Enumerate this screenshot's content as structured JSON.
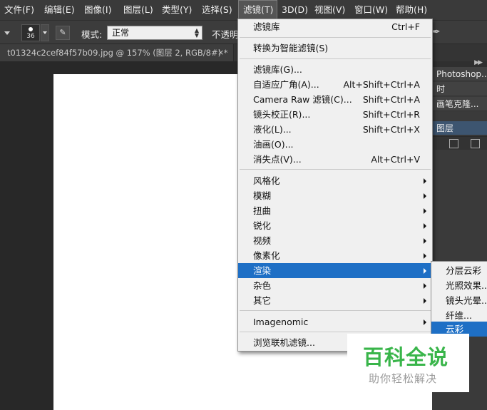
{
  "menubar": {
    "items": [
      "文件(F)",
      "编辑(E)",
      "图像(I)",
      "图层(L)",
      "类型(Y)",
      "选择(S)",
      "滤镜(T)",
      "3D(D)",
      "视图(V)",
      "窗口(W)",
      "帮助(H)"
    ]
  },
  "options": {
    "brush_size": "36",
    "mode_label": "模式:",
    "mode_value": "正常",
    "opacity_label": "不透明"
  },
  "document": {
    "tab_title": "t01324c2cef84f57b09.jpg @ 157% (图层 2, RGB/8#) *",
    "close": "×"
  },
  "right_panel": {
    "rows": [
      "Photoshop...",
      "时",
      "画笔克隆...",
      "图层"
    ]
  },
  "filter_menu": {
    "items": [
      {
        "label": "滤镜库",
        "shortcut": "Ctrl+F"
      },
      {
        "label": "转换为智能滤镜(S)",
        "shortcut": ""
      },
      {
        "label": "滤镜库(G)...",
        "shortcut": ""
      },
      {
        "label": "自适应广角(A)...",
        "shortcut": "Alt+Shift+Ctrl+A"
      },
      {
        "label": "Camera Raw 滤镜(C)...",
        "shortcut": "Shift+Ctrl+A"
      },
      {
        "label": "镜头校正(R)...",
        "shortcut": "Shift+Ctrl+R"
      },
      {
        "label": "液化(L)...",
        "shortcut": "Shift+Ctrl+X"
      },
      {
        "label": "油画(O)...",
        "shortcut": ""
      },
      {
        "label": "消失点(V)...",
        "shortcut": "Alt+Ctrl+V"
      },
      {
        "label": "风格化",
        "shortcut": ""
      },
      {
        "label": "模糊",
        "shortcut": ""
      },
      {
        "label": "扭曲",
        "shortcut": ""
      },
      {
        "label": "锐化",
        "shortcut": ""
      },
      {
        "label": "视频",
        "shortcut": ""
      },
      {
        "label": "像素化",
        "shortcut": ""
      },
      {
        "label": "渲染",
        "shortcut": ""
      },
      {
        "label": "杂色",
        "shortcut": ""
      },
      {
        "label": "其它",
        "shortcut": ""
      },
      {
        "label": "Imagenomic",
        "shortcut": ""
      },
      {
        "label": "浏览联机滤镜...",
        "shortcut": ""
      }
    ]
  },
  "render_submenu": {
    "items": [
      "分层云彩",
      "光照效果...",
      "镜头光晕...",
      "纤维...",
      "云彩"
    ]
  },
  "watermark": {
    "title": "百科全说",
    "subtitle": "助你轻松解决"
  },
  "colors": {
    "highlight": "#1e6fc5",
    "menu_bg": "#f0f0f0",
    "app_bg": "#282828",
    "watermark_green": "#39b54a"
  }
}
